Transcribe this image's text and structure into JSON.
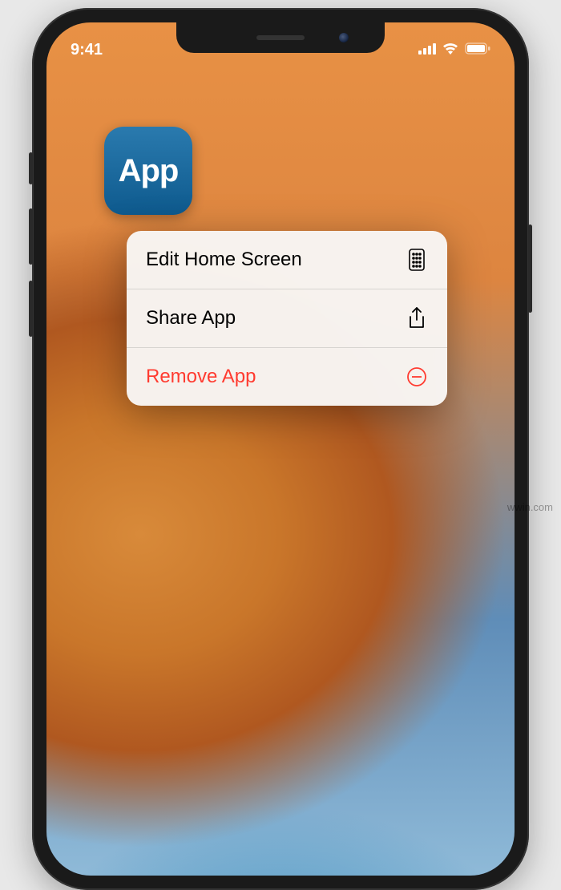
{
  "status_bar": {
    "time": "9:41"
  },
  "app_icon": {
    "label": "App"
  },
  "context_menu": {
    "items": [
      {
        "label": "Edit Home Screen",
        "icon": "home-grid-icon",
        "destructive": false
      },
      {
        "label": "Share App",
        "icon": "share-icon",
        "destructive": false
      },
      {
        "label": "Remove App",
        "icon": "remove-circle-icon",
        "destructive": true
      }
    ]
  },
  "colors": {
    "destructive": "#ff3b30",
    "app_icon_bg_top": "#2a7aae",
    "app_icon_bg_bottom": "#0e5a8e"
  },
  "watermark": "wwin.com"
}
